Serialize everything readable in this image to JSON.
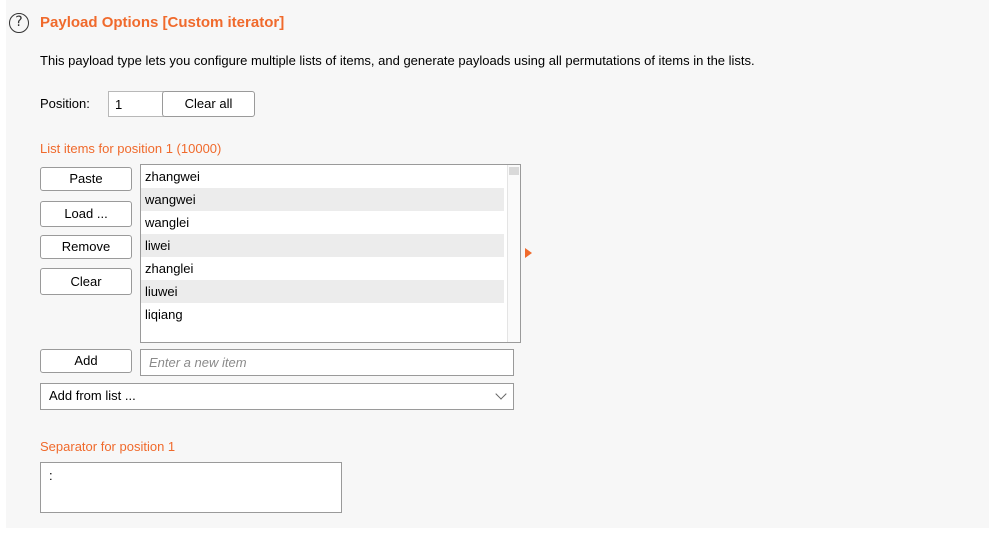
{
  "section": {
    "title": "Payload Options [Custom iterator]",
    "help_icon": "question-circle-icon",
    "description": "This payload type lets you configure multiple lists of items, and generate payloads using all permutations of items in the lists."
  },
  "position": {
    "label": "Position:",
    "value": "1",
    "clear_all_label": "Clear all"
  },
  "list": {
    "header": "List items for position 1 (10000)",
    "buttons": {
      "paste": "Paste",
      "load": "Load ...",
      "remove": "Remove",
      "clear": "Clear"
    },
    "items": [
      "zhangwei",
      "wangwei",
      "wanglei",
      "liwei",
      "zhanglei",
      "liuwei",
      "liqiang"
    ],
    "add_label": "Add",
    "new_item_placeholder": "Enter a new item",
    "add_from_list_label": "Add from list ..."
  },
  "separator": {
    "label": "Separator for position 1",
    "value": ":"
  },
  "colors": {
    "accent": "#f06a2c"
  }
}
